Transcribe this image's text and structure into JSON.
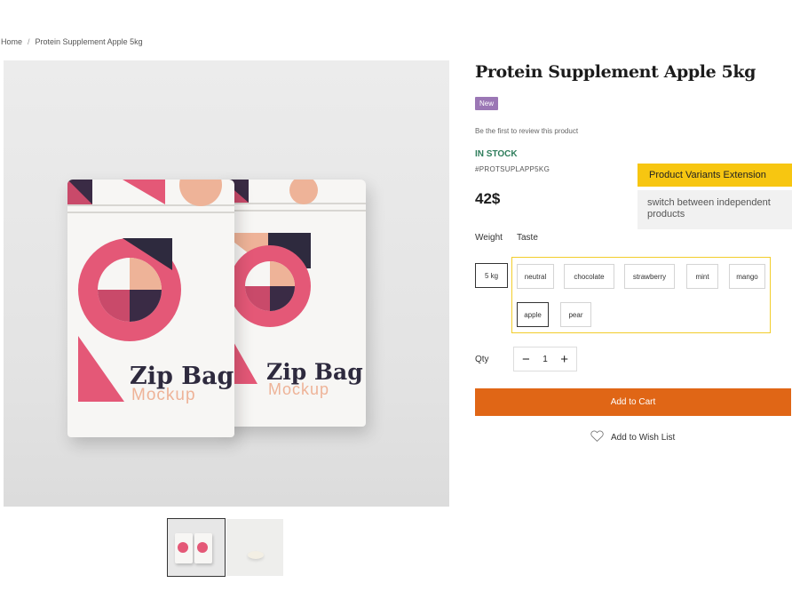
{
  "breadcrumb": {
    "home": "Home",
    "separator": "/",
    "current": "Protein Supplement Apple 5kg"
  },
  "product": {
    "title": "Protein Supplement Apple 5kg",
    "badge": "New",
    "review_link": "Be the first to review this product",
    "stock": "IN STOCK",
    "sku": "#PROTSUPLAPP5KG",
    "price": "42$"
  },
  "image": {
    "brand_line1": "Zip Bag",
    "brand_line2": "Mockup"
  },
  "extension": {
    "title": "Product Variants Extension",
    "description": "switch between independent products"
  },
  "options": {
    "weight_label": "Weight",
    "taste_label": "Taste",
    "weights": [
      "5 kg"
    ],
    "tastes": [
      "neutral",
      "chocolate",
      "strawberry",
      "mint",
      "mango",
      "apple",
      "pear"
    ],
    "selected_weight": "5 kg",
    "selected_taste": "apple"
  },
  "qty": {
    "label": "Qty",
    "minus": "−",
    "value": "1",
    "plus": "+"
  },
  "actions": {
    "add_to_cart": "Add to Cart",
    "wishlist": "Add to Wish List"
  },
  "colors": {
    "accent": "#e06616",
    "new_badge": "#9b77b5",
    "stock": "#2e7d5b",
    "extension": "#f7c611",
    "highlight_border": "#f2cd2b"
  },
  "icons": {
    "wishlist": "heart-outline-icon"
  }
}
